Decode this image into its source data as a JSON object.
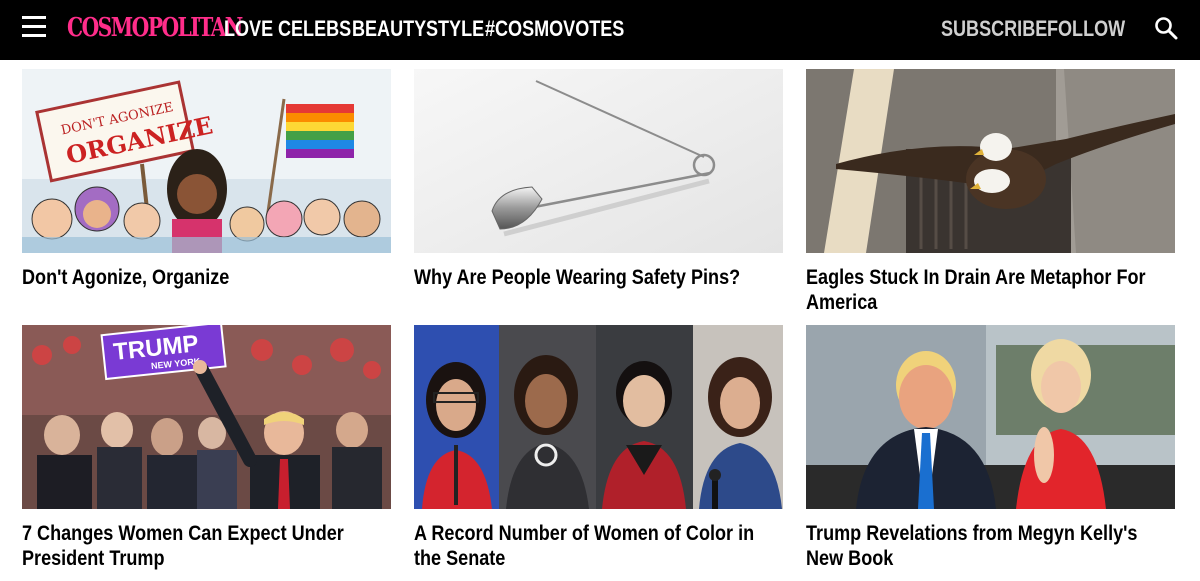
{
  "header": {
    "logo": "COSMOPOLITAN",
    "nav": [
      "LOVE",
      "CELEBS",
      "BEAUTY",
      "STYLE",
      "#COSMOVOTES"
    ],
    "nav_right": [
      "SUBSCRIBE",
      "FOLLOW"
    ],
    "icons": [
      "menu-icon",
      "search-icon"
    ],
    "colors": {
      "bar": "#000000",
      "logo": "#ff2d8a",
      "nav": "#ffffff",
      "nav_right": "#cfcfcf"
    }
  },
  "articles": [
    {
      "title": "Don't Agonize, Organize",
      "sign_text": "DON'T AGONIZE ORGANIZE"
    },
    {
      "title": "Why Are People Wearing Safety Pins?"
    },
    {
      "title": "Eagles Stuck In Drain Are Metaphor For America"
    },
    {
      "title": "7 Changes Women Can Expect Under President Trump",
      "sign_text": "TRUMP",
      "sign_subtext": "NEW YORK"
    },
    {
      "title": "A Record Number of Women of Color in the Senate"
    },
    {
      "title": "Trump Revelations from Megyn Kelly's New Book"
    }
  ]
}
